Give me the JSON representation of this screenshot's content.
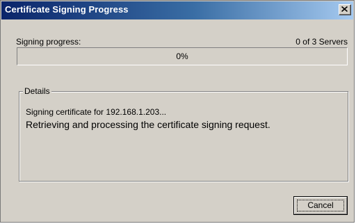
{
  "window": {
    "title": "Certificate Signing Progress"
  },
  "progress": {
    "label": "Signing progress:",
    "count_text": "0 of 3 Servers",
    "percent_text": "0%",
    "fraction": 0
  },
  "details": {
    "legend": "Details",
    "line1": "Signing certificate for 192.168.1.203...",
    "line2": "Retrieving and processing the certificate signing request."
  },
  "buttons": {
    "cancel_label": "Cancel"
  },
  "icons": {
    "close": "close-icon"
  },
  "colors": {
    "title_bar_start": "#0a246a",
    "title_bar_end": "#a6caf0",
    "dialog_face": "#d4d0c8"
  }
}
